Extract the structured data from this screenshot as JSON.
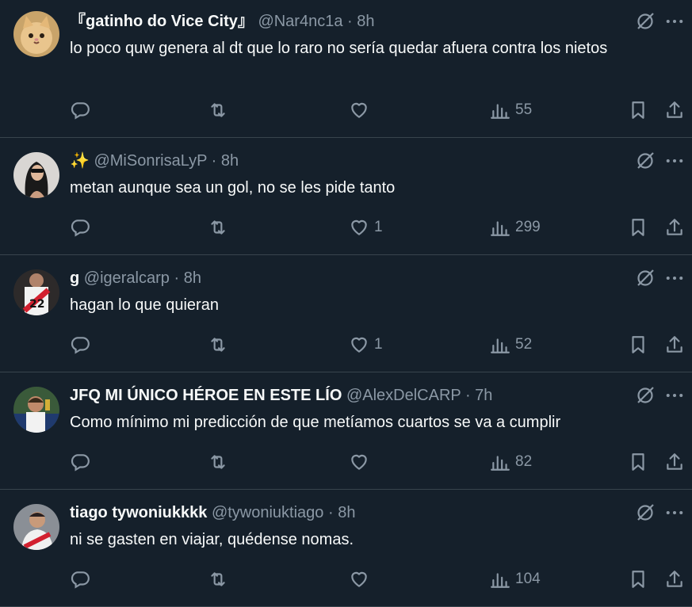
{
  "colors": {
    "background": "#15202b",
    "text": "#f7f9f9",
    "muted": "#8b98a5",
    "divider": "#38444d"
  },
  "tweets": [
    {
      "name": "『gatinho do Vice City』",
      "handle": "@Nar4nc1a",
      "separator": "·",
      "time": "8h",
      "text": "lo poco quw genera al dt que lo raro no sería quedar afuera contra los nietos",
      "replies": "",
      "retweets": "",
      "likes": "",
      "views": "55",
      "avatar_icon": "kitten-avatar"
    },
    {
      "name": "✨",
      "handle": "@MiSonrisaLyP",
      "separator": "·",
      "time": "8h",
      "text": "metan aunque sea un gol, no se les pide tanto",
      "replies": "",
      "retweets": "",
      "likes": "1",
      "views": "299",
      "avatar_icon": "woman-avatar"
    },
    {
      "name": "g",
      "handle": "@igeralcarp",
      "separator": "·",
      "time": "8h",
      "text": "hagan lo que quieran",
      "replies": "",
      "retweets": "",
      "likes": "1",
      "views": "52",
      "avatar_icon": "jersey-avatar"
    },
    {
      "name": "JFQ MI ÚNICO HÉROE EN ESTE LÍO",
      "handle": "@AlexDelCARP",
      "separator": "·",
      "time": "7h",
      "text": "Como mínimo mi predicción de que metíamos cuartos se va a cumplir",
      "replies": "",
      "retweets": "",
      "likes": "",
      "views": "82",
      "avatar_icon": "player-avatar"
    },
    {
      "name": "tiago tywoniukkkk",
      "handle": "@tywoniuktiago",
      "separator": "·",
      "time": "8h",
      "text": "ni se gasten en viajar, quédense nomas.",
      "replies": "",
      "retweets": "",
      "likes": "",
      "views": "104",
      "avatar_icon": "fan-avatar"
    }
  ]
}
